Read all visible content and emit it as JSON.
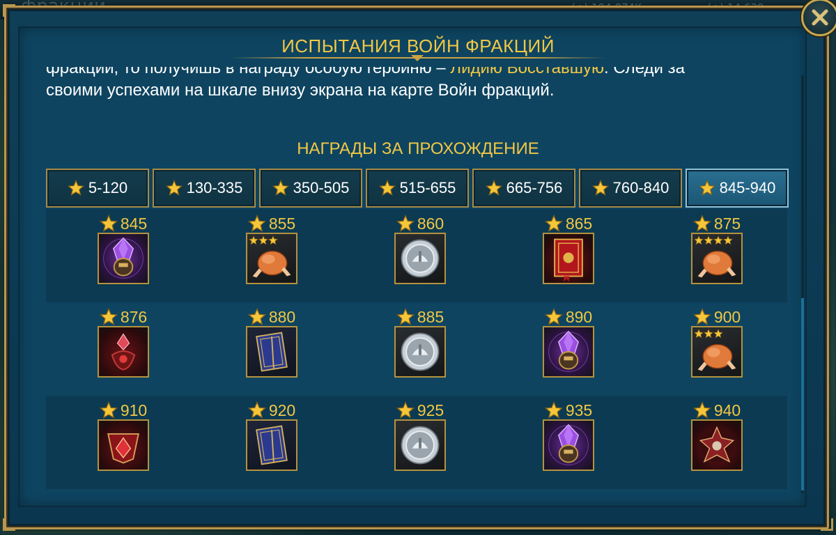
{
  "background": {
    "title": "фракции",
    "resource_1": "(+) 194 874K",
    "resource_2": "(+) 14 639"
  },
  "modal": {
    "title": "ИСПЫТАНИЯ ВОЙН ФРАКЦИЙ",
    "description_line1_pre": "фракции, то получишь в награду особую героиню – ",
    "description_line1_hl": "Лидию Восставшую",
    "description_line1_post": ". Следи за",
    "description_line2": "своими успехами на шкале внизу экрана на карте Войн фракций.",
    "section_title": "НАГРАДЫ ЗА ПРОХОЖДЕНИЕ",
    "close_icon": "close-icon",
    "scroll_position": 0.53
  },
  "tabs": [
    {
      "label": "5-120",
      "active": false
    },
    {
      "label": "130-335",
      "active": false
    },
    {
      "label": "350-505",
      "active": false
    },
    {
      "label": "515-655",
      "active": false
    },
    {
      "label": "665-756",
      "active": false
    },
    {
      "label": "760-840",
      "active": false
    },
    {
      "label": "845-940",
      "active": true
    }
  ],
  "rewards": [
    [
      {
        "stars": "845",
        "item": "purple-shard-icon",
        "rank_stars": 0
      },
      {
        "stars": "855",
        "item": "chicken-icon",
        "rank_stars": 3
      },
      {
        "stars": "860",
        "item": "silver-coin-icon",
        "rank_stars": 0
      },
      {
        "stars": "865",
        "item": "red-tome-icon",
        "rank_stars": 0
      },
      {
        "stars": "875",
        "item": "chicken-icon",
        "rank_stars": 4
      }
    ],
    [
      {
        "stars": "876",
        "item": "red-shard-icon",
        "rank_stars": 0
      },
      {
        "stars": "880",
        "item": "blue-tome-icon",
        "rank_stars": 0
      },
      {
        "stars": "885",
        "item": "silver-coin-icon",
        "rank_stars": 0
      },
      {
        "stars": "890",
        "item": "purple-shard-icon",
        "rank_stars": 0
      },
      {
        "stars": "900",
        "item": "chicken-icon",
        "rank_stars": 3
      }
    ],
    [
      {
        "stars": "910",
        "item": "red-artifact-icon",
        "rank_stars": 0
      },
      {
        "stars": "920",
        "item": "blue-tome-icon",
        "rank_stars": 0
      },
      {
        "stars": "925",
        "item": "silver-coin-icon",
        "rank_stars": 0
      },
      {
        "stars": "935",
        "item": "purple-shard-icon",
        "rank_stars": 0
      },
      {
        "stars": "940",
        "item": "sacred-shard-icon",
        "rank_stars": 0
      }
    ]
  ],
  "colors": {
    "gold": "#f2c744",
    "frame": "#b9974f",
    "panel": "#0e4460",
    "tab_active": "#2a6f92"
  }
}
